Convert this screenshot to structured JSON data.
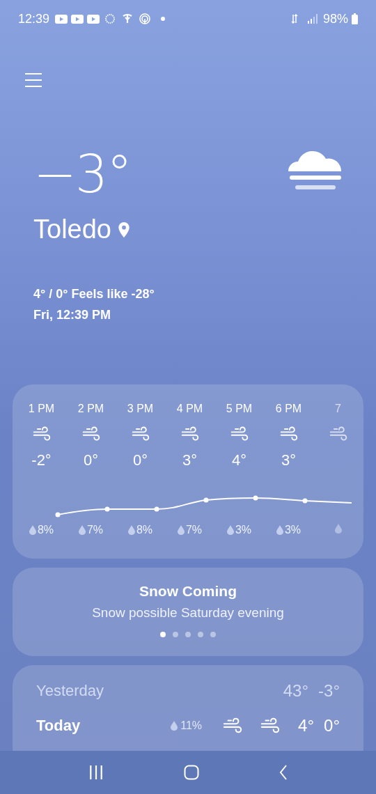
{
  "status_bar": {
    "time": "12:39",
    "battery": "98%"
  },
  "current": {
    "temperature": "−3°",
    "location": "Toledo",
    "high_low_feels": "4° / 0° Feels like -28°",
    "datetime": "Fri, 12:39 PM"
  },
  "hourly": [
    {
      "time": "1 PM",
      "temp": "-2°",
      "precip": "8%",
      "faded": false
    },
    {
      "time": "2 PM",
      "temp": "0°",
      "precip": "7%",
      "faded": false
    },
    {
      "time": "3 PM",
      "temp": "0°",
      "precip": "8%",
      "faded": false
    },
    {
      "time": "4 PM",
      "temp": "3°",
      "precip": "7%",
      "faded": false
    },
    {
      "time": "5 PM",
      "temp": "4°",
      "precip": "3%",
      "faded": false
    },
    {
      "time": "6 PM",
      "temp": "3°",
      "precip": "3%",
      "faded": false
    },
    {
      "time": "7",
      "faded": true
    }
  ],
  "alert": {
    "title": "Snow Coming",
    "text": "Snow possible Saturday evening",
    "pages": [
      {
        "selected": true
      },
      {
        "selected": false
      },
      {
        "selected": false
      },
      {
        "selected": false
      },
      {
        "selected": false
      }
    ]
  },
  "daily": [
    {
      "day": "Yesterday",
      "dimmed": true,
      "wind_icons": false,
      "high": "43°",
      "low": "-3°"
    },
    {
      "day": "Today",
      "dimmed": false,
      "precip": "11%",
      "wind_icons": true,
      "high": "4°",
      "low": "0°"
    }
  ]
}
